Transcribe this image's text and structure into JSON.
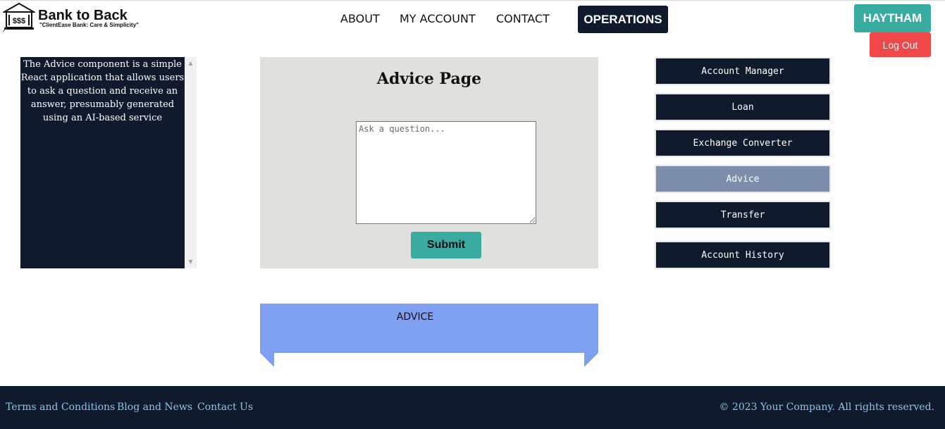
{
  "brand": {
    "title": "Bank to Back",
    "tagline": "\"ClientEase Bank:  Care & Simplicity\"",
    "icon": "bank-building-icon"
  },
  "nav": {
    "links": [
      "ABOUT",
      "MY ACCOUNT",
      "CONTACT"
    ],
    "active": "OPERATIONS"
  },
  "user": {
    "name": "HAYTHAM",
    "logout_label": "Log Out"
  },
  "sidebar": {
    "description": "The Advice component is a simple React application that allows users to ask a question and receive an answer, presumably generated using an AI-based service"
  },
  "advice": {
    "title": "Advice Page",
    "question_value": "",
    "question_placeholder": "Ask a question...",
    "submit_label": "Submit"
  },
  "operations": {
    "items": [
      "Account Manager",
      "Loan",
      "Exchange Converter",
      "Advice",
      "Transfer",
      "Account History"
    ],
    "selected": "Advice"
  },
  "ribbon": {
    "label": "ADVICE"
  },
  "footer": {
    "links": [
      "Terms and Conditions",
      "Blog and News",
      "Contact Us"
    ],
    "copyright": "© 2023 Your Company. All rights reserved."
  },
  "colors": {
    "navy": "#0f1b2d",
    "teal": "#3aaba0",
    "red": "#f04848",
    "card_bg": "#e0e0dc",
    "selected_item": "#7c8eac",
    "ribbon": "#7fa0f0",
    "footer_link": "#8ec4e6"
  }
}
